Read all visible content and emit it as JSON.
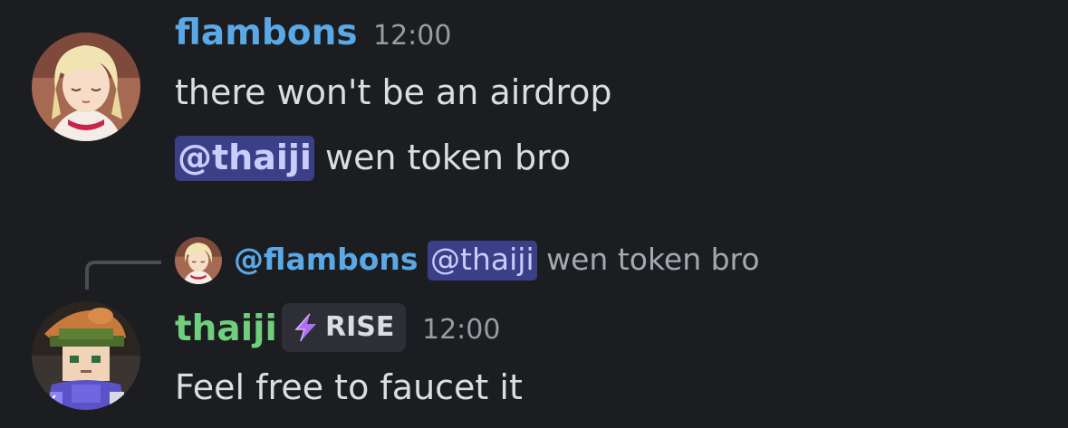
{
  "messages": [
    {
      "author": "flambons",
      "author_color": "#5aa8e6",
      "timestamp": "12:00",
      "avatar_icon": "anime-girl-avatar",
      "lines": [
        {
          "text": "there won't be an airdrop"
        },
        {
          "mention": "@thaiji",
          "text": " wen token bro"
        }
      ]
    },
    {
      "reply_to": {
        "author": "@flambons",
        "mention": "@thaiji",
        "text": " wen token bro",
        "avatar_icon": "anime-girl-avatar"
      },
      "author": "thaiji",
      "author_color": "#6fcf7d",
      "badge": {
        "icon": "lightning-icon",
        "label": "RISE",
        "icon_color": "#b06cf5"
      },
      "timestamp": "12:00",
      "avatar_icon": "pixel-adventurer-avatar",
      "lines": [
        {
          "text": "Feel free to faucet it"
        }
      ]
    }
  ]
}
